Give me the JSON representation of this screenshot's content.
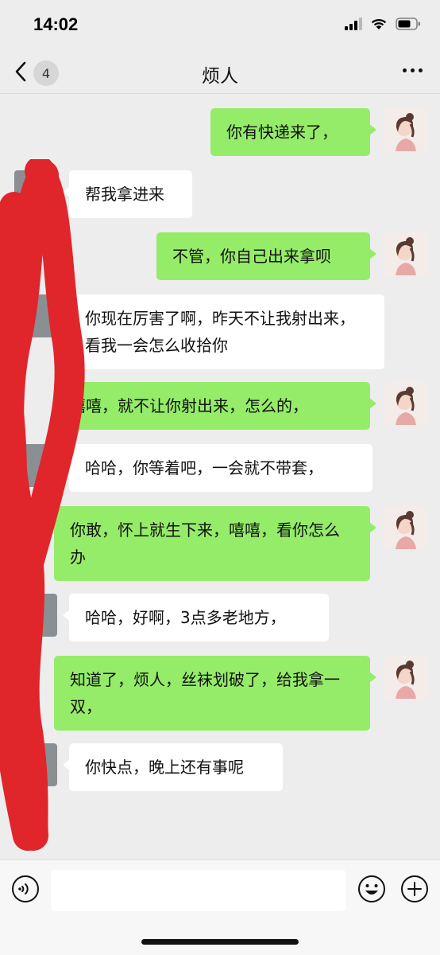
{
  "status_bar": {
    "time": "14:02"
  },
  "nav": {
    "unread_count": "4",
    "title": "烦人"
  },
  "messages": [
    {
      "from": "me",
      "text": "你有快递来了，"
    },
    {
      "from": "other",
      "text": "帮我拿进来"
    },
    {
      "from": "me",
      "text": "不管，你自己出来拿呗"
    },
    {
      "from": "other",
      "text": "你现在厉害了啊，昨天不让我射出来，看我一会怎么收拾你"
    },
    {
      "from": "me",
      "text": "嘻嘻，就不让你射出来，怎么的，"
    },
    {
      "from": "other",
      "text": "哈哈，你等着吧，一会就不带套，"
    },
    {
      "from": "me",
      "text": "你敢，怀上就生下来，嘻嘻，看你怎么办"
    },
    {
      "from": "other",
      "text": "哈哈，好啊，3点多老地方，"
    },
    {
      "from": "me",
      "text": "知道了，烦人，丝袜划破了，给我拿一双，"
    },
    {
      "from": "other",
      "text": "你快点，晚上还有事呢"
    }
  ],
  "input": {
    "value": ""
  },
  "colors": {
    "background": "#ededed",
    "bubble_me": "#95ec69",
    "bubble_other": "#ffffff",
    "redaction": "#e0262b"
  }
}
